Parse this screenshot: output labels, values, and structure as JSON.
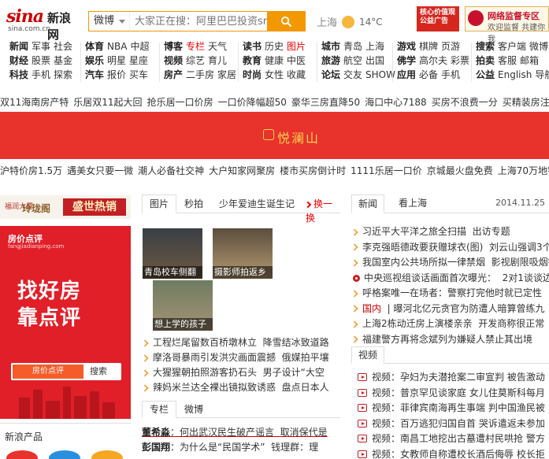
{
  "header": {
    "logo_mark": "sina",
    "logo_cn": "新浪网",
    "logo_domain": "sina.com.cn",
    "search_channel": "微博",
    "search_placeholder": "大家正在搜：阿里巴巴投资sm",
    "weather_city": "上海",
    "weather_temp": "14°C",
    "ad_left": "核心价值观 公益广告",
    "ad_right_title": "网络监督专区",
    "ad_right_sub": "欢迎监督 共建你我"
  },
  "nav": {
    "columns": [
      [
        "新闻",
        "军事",
        "社会",
        "财经",
        "股票",
        "基金",
        "科技",
        "手机",
        "探索"
      ],
      [
        "体育",
        "NBA",
        "中超",
        "娱乐",
        "明星",
        "星座",
        "汽车",
        "报价",
        "买车"
      ],
      [
        "博客",
        "专栏",
        "天气",
        "视频",
        "综艺",
        "育儿",
        "房产",
        "二手房",
        "家居"
      ],
      [
        "读书",
        "历史",
        "图片",
        "教育",
        "健康",
        "中医",
        "时尚",
        "女性",
        "收藏"
      ],
      [
        "城市",
        "青岛",
        "上海",
        "旅游",
        "航空",
        "出国",
        "论坛",
        "交友",
        "SHOW"
      ],
      [
        "游戏",
        "棋牌",
        "页游",
        "佛学",
        "高尔夫",
        "彩票",
        "应用",
        "必备",
        "手机"
      ],
      [
        "搜索",
        "客户端",
        "微博",
        "拍卖",
        "客服",
        "邮箱",
        "公益",
        "English",
        "导航"
      ]
    ]
  },
  "ad_row1": [
    "双11海南房产特",
    "乐居双11起大回",
    "抢乐居一口价房",
    "一口价降幅超50",
    "豪华三房直降50",
    "海口中心7188",
    "买房不浪费一分",
    "买精装房注意事"
  ],
  "banner": {
    "brand": "悦澜山"
  },
  "ad_row2": [
    "沪特价房1.5万",
    "遇美女只要一微",
    "潮人必备社交神",
    "大户知家网聚房",
    "楼市买房倒计时",
    "1111乐居一口价",
    "京城最火盘免费",
    "上海70万地铁房"
  ],
  "left": {
    "ad1_logo": "福润大厦",
    "ad1_name": "玲珑阁",
    "ad1_slogan": "盛世热销",
    "ad2_brand": "房价点评",
    "ad2_sub": "fangjiadianping.com",
    "ad2_title1": "找好房",
    "ad2_title2": "靠点评",
    "ad2_bar_left": "房价点评",
    "ad2_bar_right": "搜索",
    "products_title": "新浪产品"
  },
  "mid": {
    "tabs": [
      "图片",
      "秒拍",
      "少年爱迪生诞生记"
    ],
    "refresh": "换一换",
    "thumbs": [
      "青岛校车侧翻",
      "摄影师拍返乡",
      "想上学的孩子"
    ],
    "list1": [
      "工程烂尾留数百桥墩林立",
      "降雪结冰致道路",
      "摩洛哥暴雨引发洪灾画面震撼",
      "俄媒拍平壤",
      "大猩猩朝拍照游客扔石头",
      "男子设计“大空",
      "辣妈米兰达全裸出镜拟致诱惑",
      "盘点日本人"
    ],
    "tabs2": [
      "专栏",
      "微博"
    ],
    "list2": [
      {
        "a": "董希淼",
        "b": "：何出武汉民生破产谣言",
        "c": "取消保代是"
      },
      {
        "a": "彭国翔",
        "b": "：为什么是“民国学术”",
        "c": "钱理群：理"
      }
    ]
  },
  "right": {
    "tabs": [
      "新闻",
      "看上海"
    ],
    "date": "2014.11.25",
    "list1": [
      {
        "pre": "",
        "t": "习近平大平洋之旅全扫描",
        "t2": "出访专题"
      },
      {
        "pre": "",
        "t": "李克强晤德政要获赠球衣(图)",
        "t2": "刘云山强调3个"
      },
      {
        "pre": "",
        "t": "我国室内公共场所拟一律禁烟",
        "t2": "影视剧限吸烟镜"
      },
      {
        "pre": "dot",
        "t": "中央巡视组谈话画面首次曝光：",
        "t2": "2对1谈谈边"
      },
      {
        "pre": "",
        "t": "呼格案唯一在场者：警察打完他时就已定性",
        "t2": ""
      },
      {
        "pre": "red",
        "t": "国内",
        "t2": "| 曝河北亿元贪官为防遭人暗算曾练九"
      },
      {
        "pre": "",
        "t": "上海2栋动迁房上演楼亲亲",
        "t2": "开发商称很正常"
      },
      {
        "pre": "",
        "t": "福建警方再将念斌列为嫌疑人禁止其出境",
        "t2": ""
      }
    ],
    "tabs2": [
      "视频"
    ],
    "list2": [
      "视频：孕妇为夫潜抢案二审宣判  被告激动",
      "视频：普京罕见谈家庭  女儿住莫斯科每月",
      "视频：菲律宾南海再生事端  判中国渔民被",
      "视频：百万逃犯归国自首  哭诉遣返未参加",
      "视频：南昌工地挖出古墓遭村民哄抢  警方",
      "视频：女教师自称遭校长酒后侮辱  校长拒"
    ]
  }
}
